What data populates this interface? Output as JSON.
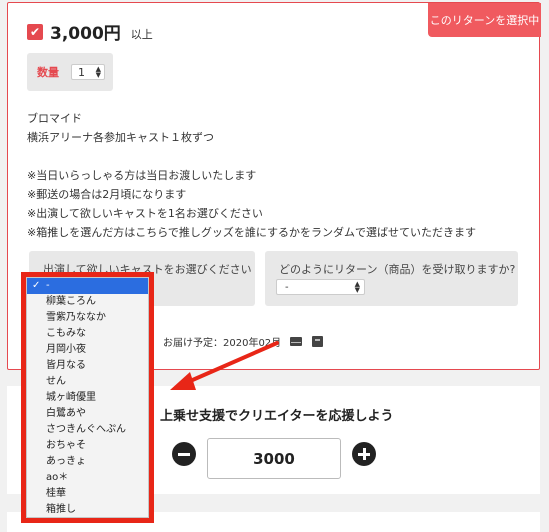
{
  "reward": {
    "select_badge": "このリターンを選択中",
    "checkbox_mark": "✔",
    "price": "3,000円",
    "price_suffix": "以上",
    "quantity_label": "数量",
    "quantity_value": "1",
    "description_lines": [
      "ブロマイド",
      "横浜アリーナ各参加キャスト１枚ずつ",
      "",
      "※当日いらっしゃる方は当日お渡しいたします",
      "※郵送の場合は2月頃になります",
      "※出演して欲しいキャストを1名お選びください",
      "※箱推しを選んだ方はこちらで推しグッズを誰にするかをランダムで選ばせていただきます"
    ],
    "question_cast_label": "出演して欲しいキャストをお選びください",
    "question_delivery_label": "どのようにリターン（商品）を受け取りますか?",
    "delivery_select_value": "-",
    "delivery_date": "お届け予定：2020年02月"
  },
  "cast_dropdown": {
    "selected_index": 0,
    "options": [
      "-",
      "柳葉ころん",
      "雪紫乃ななか",
      "こもみな",
      "月岡小夜",
      "皆月なる",
      "せん",
      "城ヶ崎優里",
      "白鷺あや",
      "さつきんぐへぷん",
      "おちゃそ",
      "あっきょ",
      "ao＊",
      "桂華",
      "箱推し"
    ]
  },
  "support": {
    "title": "上乗せ支援でクリエイターを応援しよう",
    "amount": "3000"
  },
  "colors": {
    "accent": "#e5494f",
    "badge": "#f05a5f",
    "highlight_frame": "#e82617",
    "selected_option": "#2b6de0"
  },
  "icons": [
    "checkbox-checked-icon",
    "select-arrows-icon",
    "mail-icon",
    "box-icon",
    "minus-circle-icon",
    "plus-circle-icon",
    "checkmark-icon"
  ]
}
